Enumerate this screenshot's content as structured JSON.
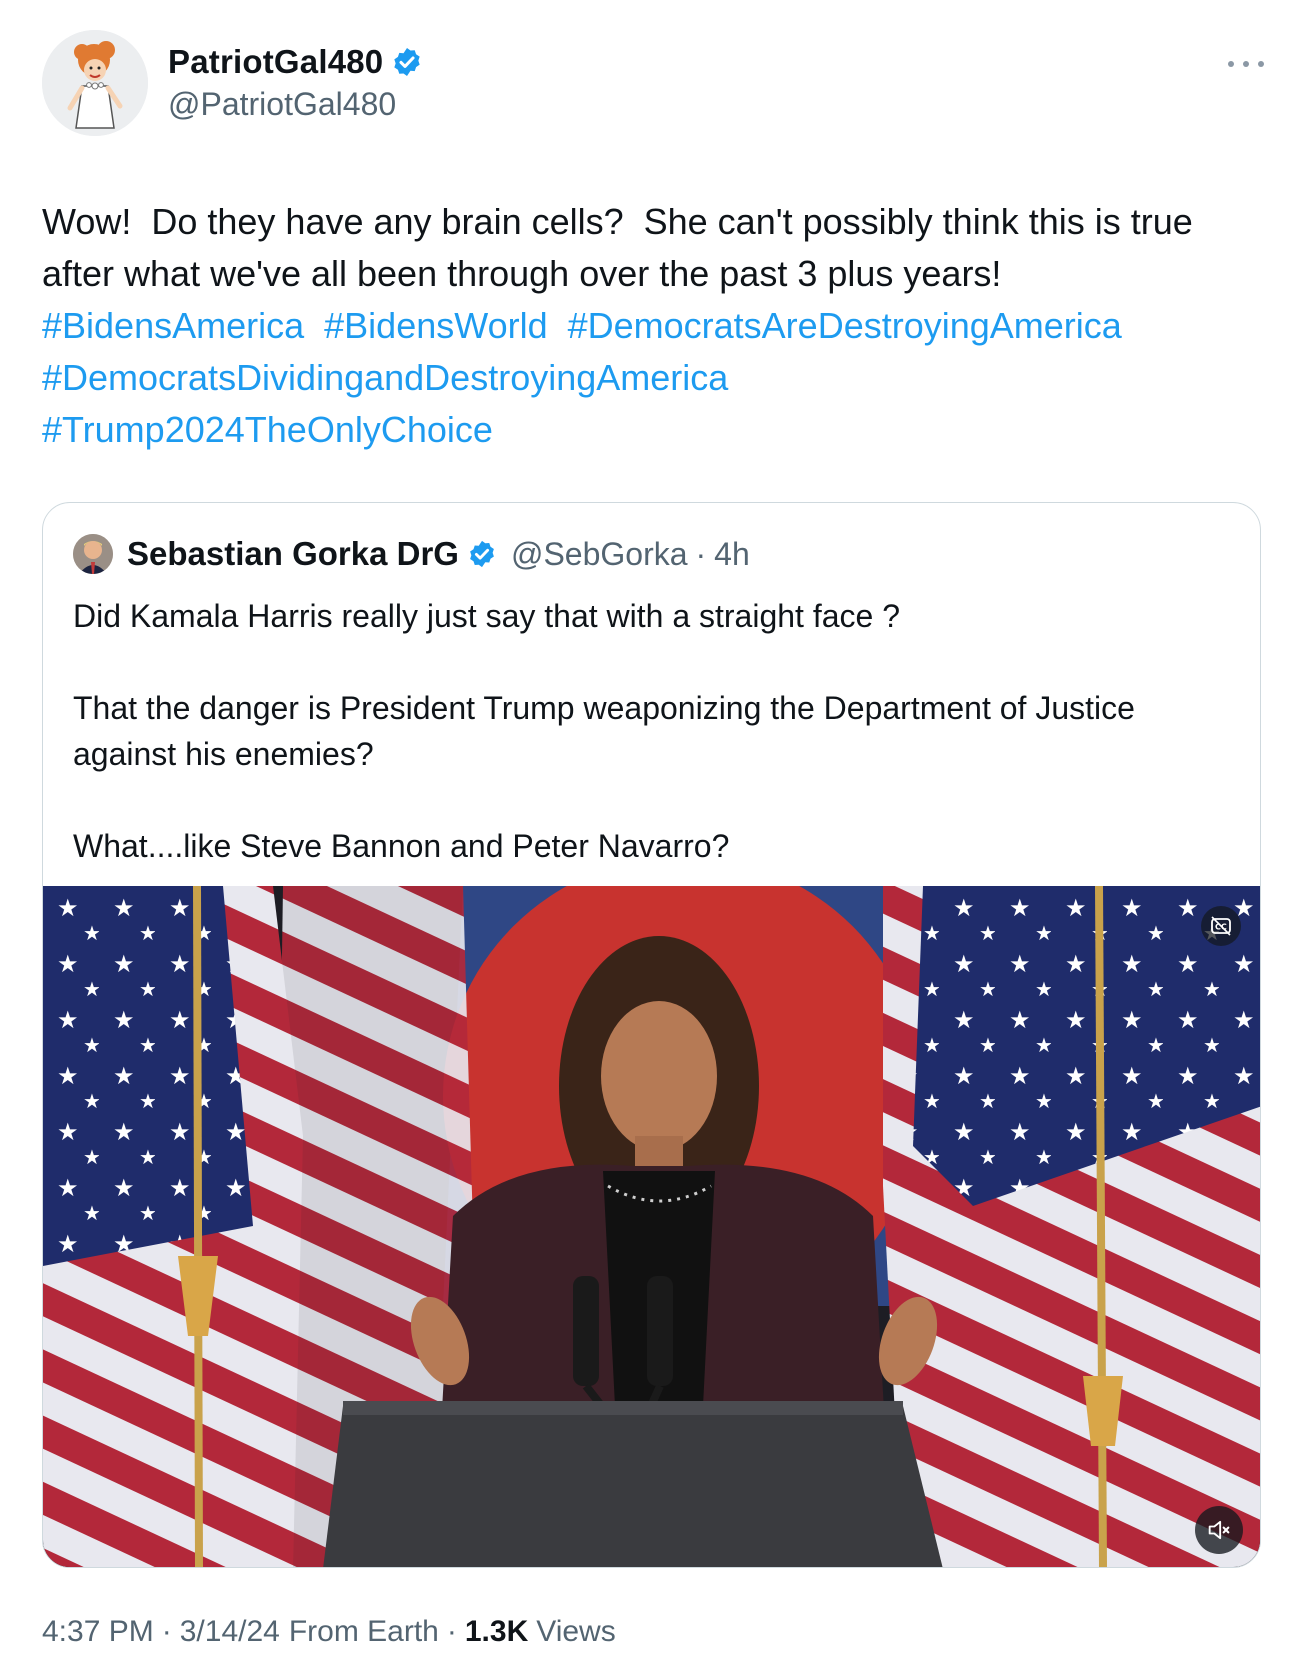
{
  "post": {
    "author": {
      "name": "PatriotGal480",
      "handle": "@PatriotGal480",
      "verified": true
    },
    "text": "Wow!  Do they have any brain cells?  She can't possibly think this is true after what we've all been through over the past 3 plus years!",
    "hashtags": [
      "#BidensAmerica",
      "#BidensWorld",
      "#DemocratsAreDestroyingAmerica",
      "#DemocratsDividingandDestroyingAmerica",
      "#Trump2024TheOnlyChoice"
    ],
    "quoted": {
      "author": {
        "name": "Sebastian Gorka DrG",
        "handle": "@SebGorka",
        "verified": true
      },
      "separator": "·",
      "age": "4h",
      "paragraphs": [
        "Did Kamala Harris really just say that with a straight face ?",
        "That the danger is President Trump weaponizing the Department of Justice against his enemies?",
        "What....like Steve Bannon and Peter Navarro?"
      ],
      "media": {
        "type": "video",
        "controls": [
          "cc-icon",
          "mute-icon"
        ]
      }
    },
    "footer": {
      "time": "4:37 PM",
      "date": "3/14/24",
      "source": "From Earth",
      "separator": "·",
      "views_count": "1.3K",
      "views_label": "Views"
    }
  },
  "icons": {
    "more": "more-dots-icon",
    "verified": "verified-badge-icon"
  },
  "colors": {
    "text": "#0f1419",
    "muted": "#536471",
    "link": "#1d9bf0",
    "border": "#cfd9de",
    "verified": "#1d9bf0"
  }
}
